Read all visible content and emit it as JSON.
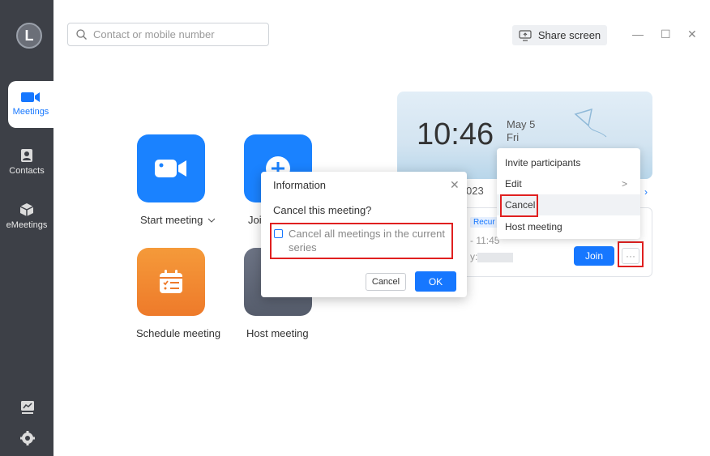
{
  "app": {
    "logo_letter": "L",
    "accent": "#1677ff"
  },
  "sidebar": {
    "items": [
      {
        "label": "Meetings",
        "icon": "video-camera-icon",
        "active": true
      },
      {
        "label": "Contacts",
        "icon": "contacts-book-icon",
        "active": false
      },
      {
        "label": "eMeetings",
        "icon": "emeetings-cube-icon",
        "active": false
      }
    ],
    "bottom_icons": [
      "screen-projection-icon",
      "settings-gear-icon"
    ]
  },
  "header": {
    "search_placeholder": "Contact or mobile number",
    "share_screen_label": "Share screen",
    "window_controls": [
      "—",
      "☐",
      "✕"
    ]
  },
  "actions": {
    "start_meeting": "Start meeting",
    "join_meeting": "Joi",
    "schedule_meeting": "Schedule meeting",
    "host_meeting": "Host meeting"
  },
  "clock": {
    "time": "10:46",
    "date": "May 5",
    "weekday": "Fri"
  },
  "meeting_card": {
    "date_fragment": "023",
    "recurring_badge": "Recur",
    "time_fragment": "- 11:45",
    "by_fragment": "y:",
    "join_label": "Join",
    "more_label": "···"
  },
  "context_menu": {
    "items": [
      {
        "label": "Invite participants"
      },
      {
        "label": "Edit",
        "has_submenu": true,
        "arrow": ">"
      },
      {
        "label": "Cancel",
        "highlighted": true
      },
      {
        "label": "Host meeting"
      }
    ]
  },
  "dialog": {
    "title": "Information",
    "close": "✕",
    "question": "Cancel this meeting?",
    "checkbox_label": "Cancel all meetings in the current series",
    "checkbox_checked": false,
    "cancel_label": "Cancel",
    "ok_label": "OK"
  }
}
